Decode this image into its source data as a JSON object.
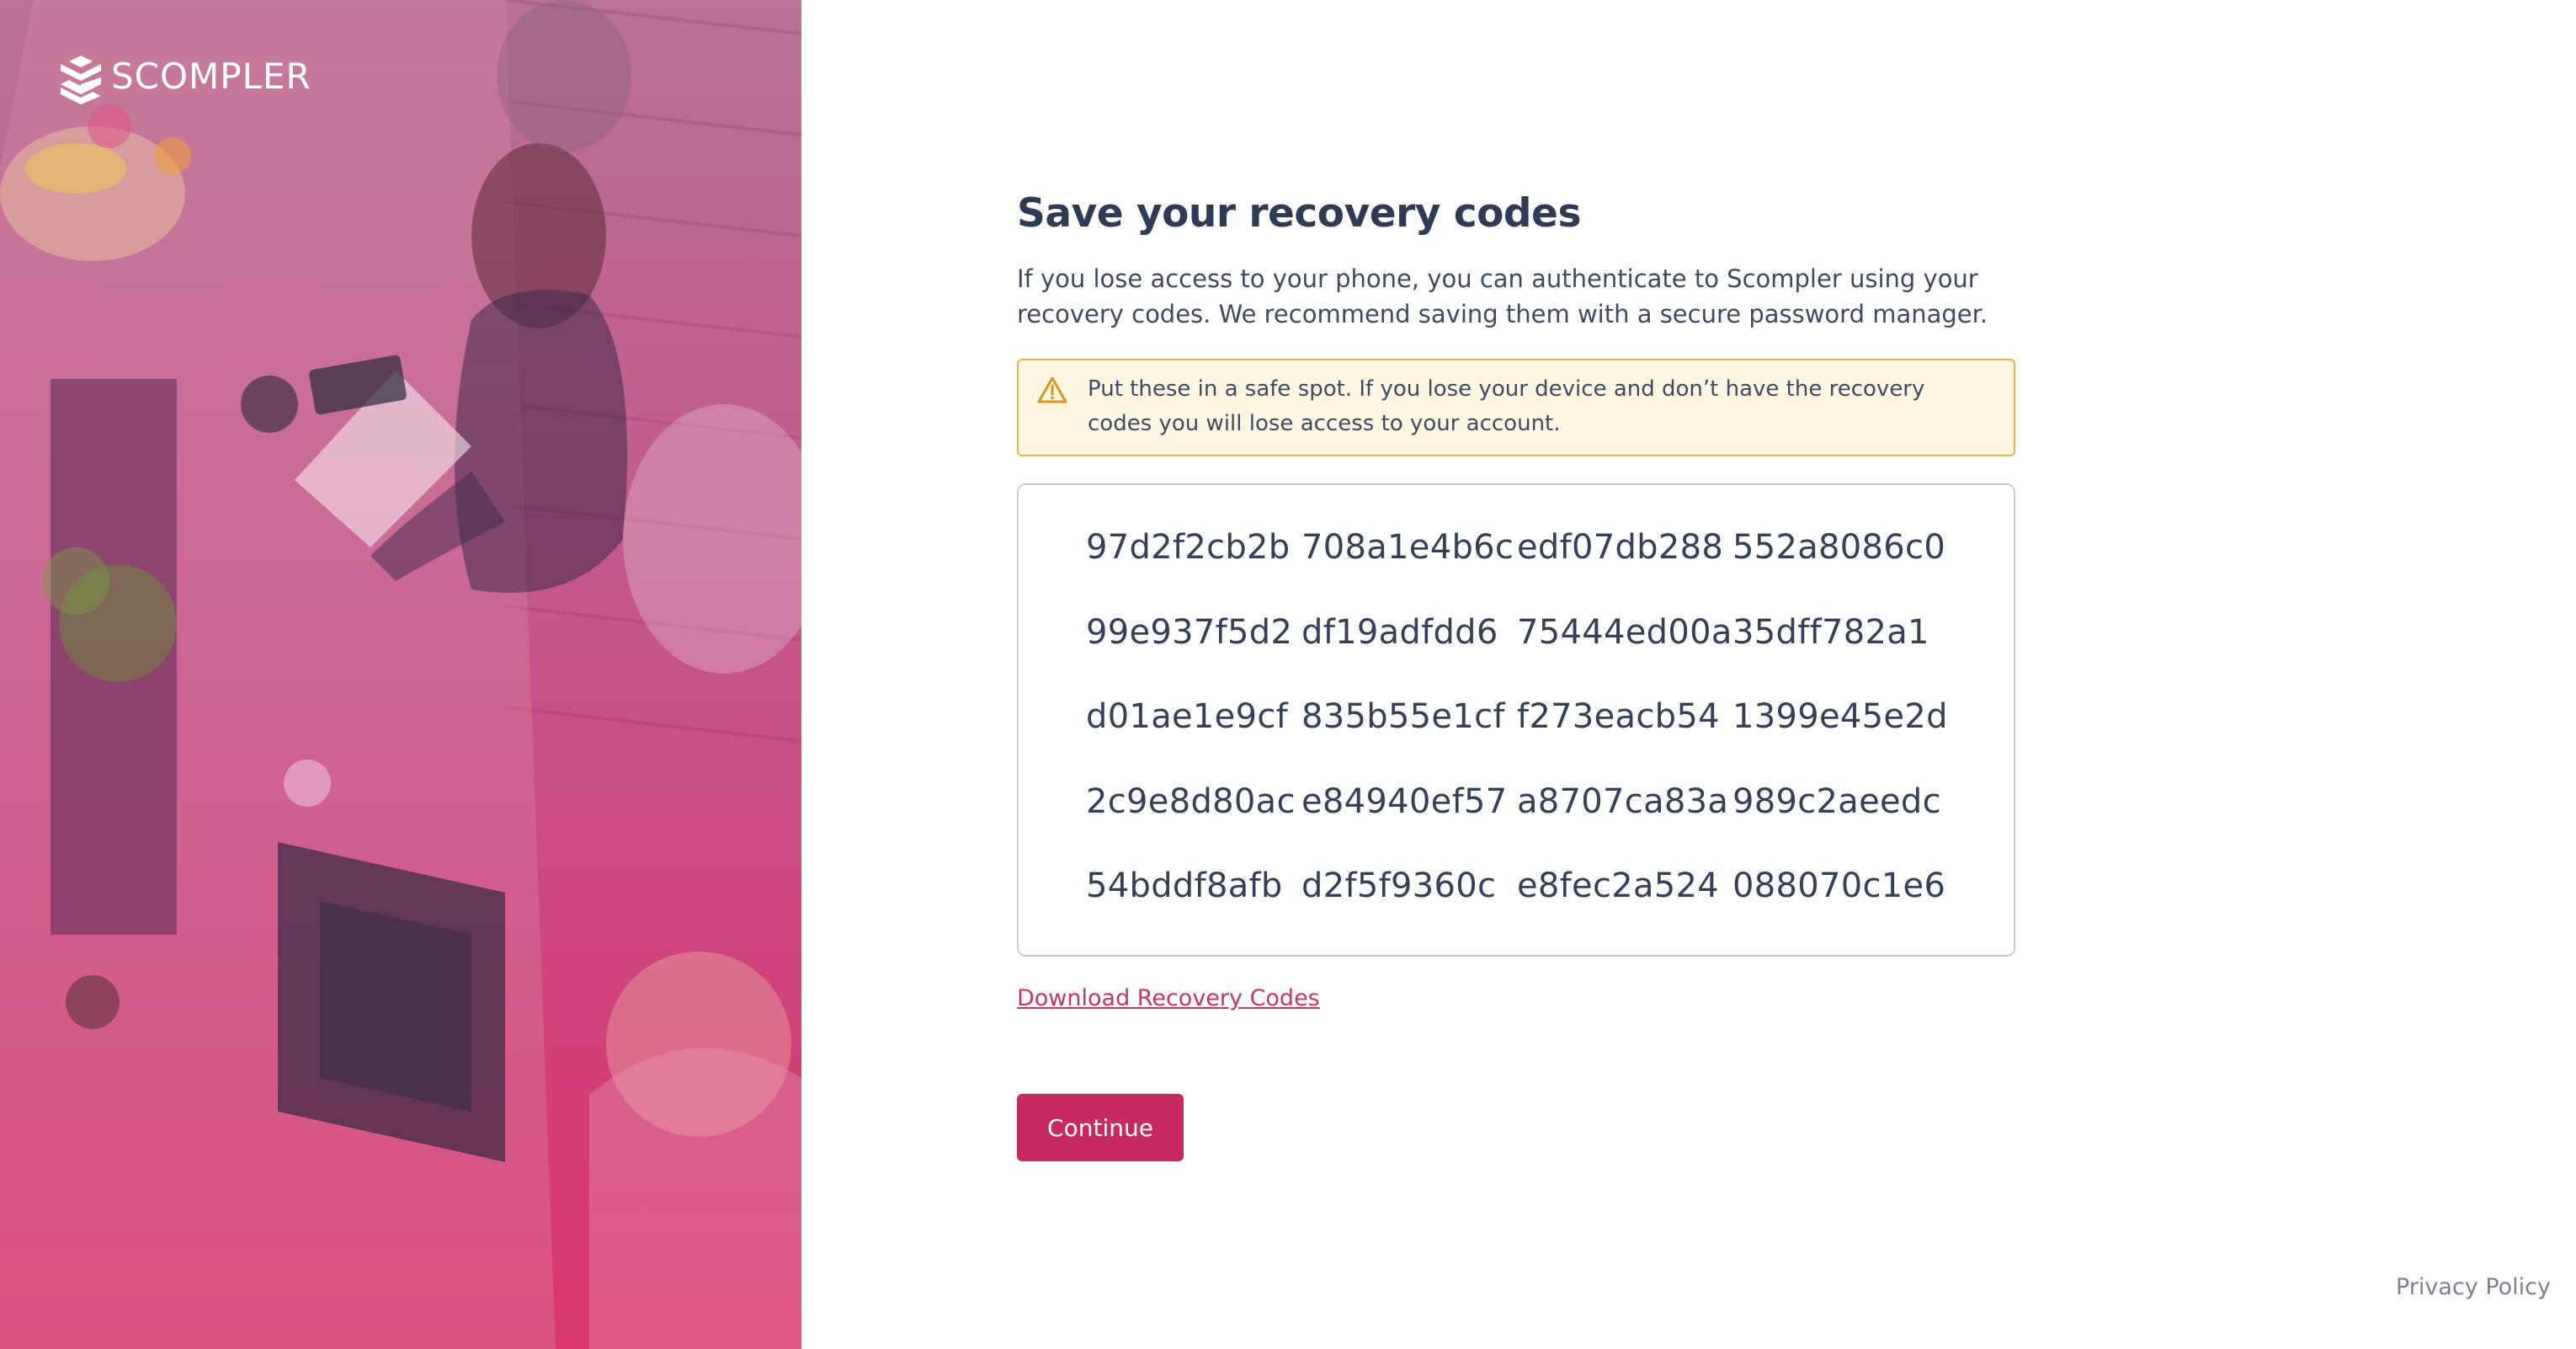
{
  "brand": {
    "name": "SCOMPLER",
    "logo_icon": "scompler-logo-icon"
  },
  "page": {
    "title": "Save your recovery codes",
    "intro": "If you lose access to your phone, you can authenticate to Scompler using your recovery codes. We recommend saving them with a secure password manager."
  },
  "warning": {
    "icon": "warning-triangle-icon",
    "text": "Put these in a safe spot. If you lose your device and don’t have the recovery codes you will lose access to your account."
  },
  "recovery_codes": [
    "97d2f2cb2b",
    "708a1e4b6c",
    "edf07db288",
    "552a8086c0",
    "99e937f5d2",
    "df19adfdd6",
    "75444ed00a",
    "35dff782a1",
    "d01ae1e9cf",
    "835b55e1cf",
    "f273eacb54",
    "1399e45e2d",
    "2c9e8d80ac",
    "e84940ef57",
    "a8707ca83a",
    "989c2aeedc",
    "54bddf8afb",
    "d2f5f9360c",
    "e8fec2a524",
    "088070c1e6"
  ],
  "actions": {
    "download_label": "Download Recovery Codes",
    "continue_label": "Continue"
  },
  "footer": {
    "privacy_label": "Privacy Policy"
  },
  "colors": {
    "accent": "#c72a63",
    "title": "#2e3b55",
    "warning_bg": "#fdf7e1",
    "warning_border": "#e6b449"
  }
}
